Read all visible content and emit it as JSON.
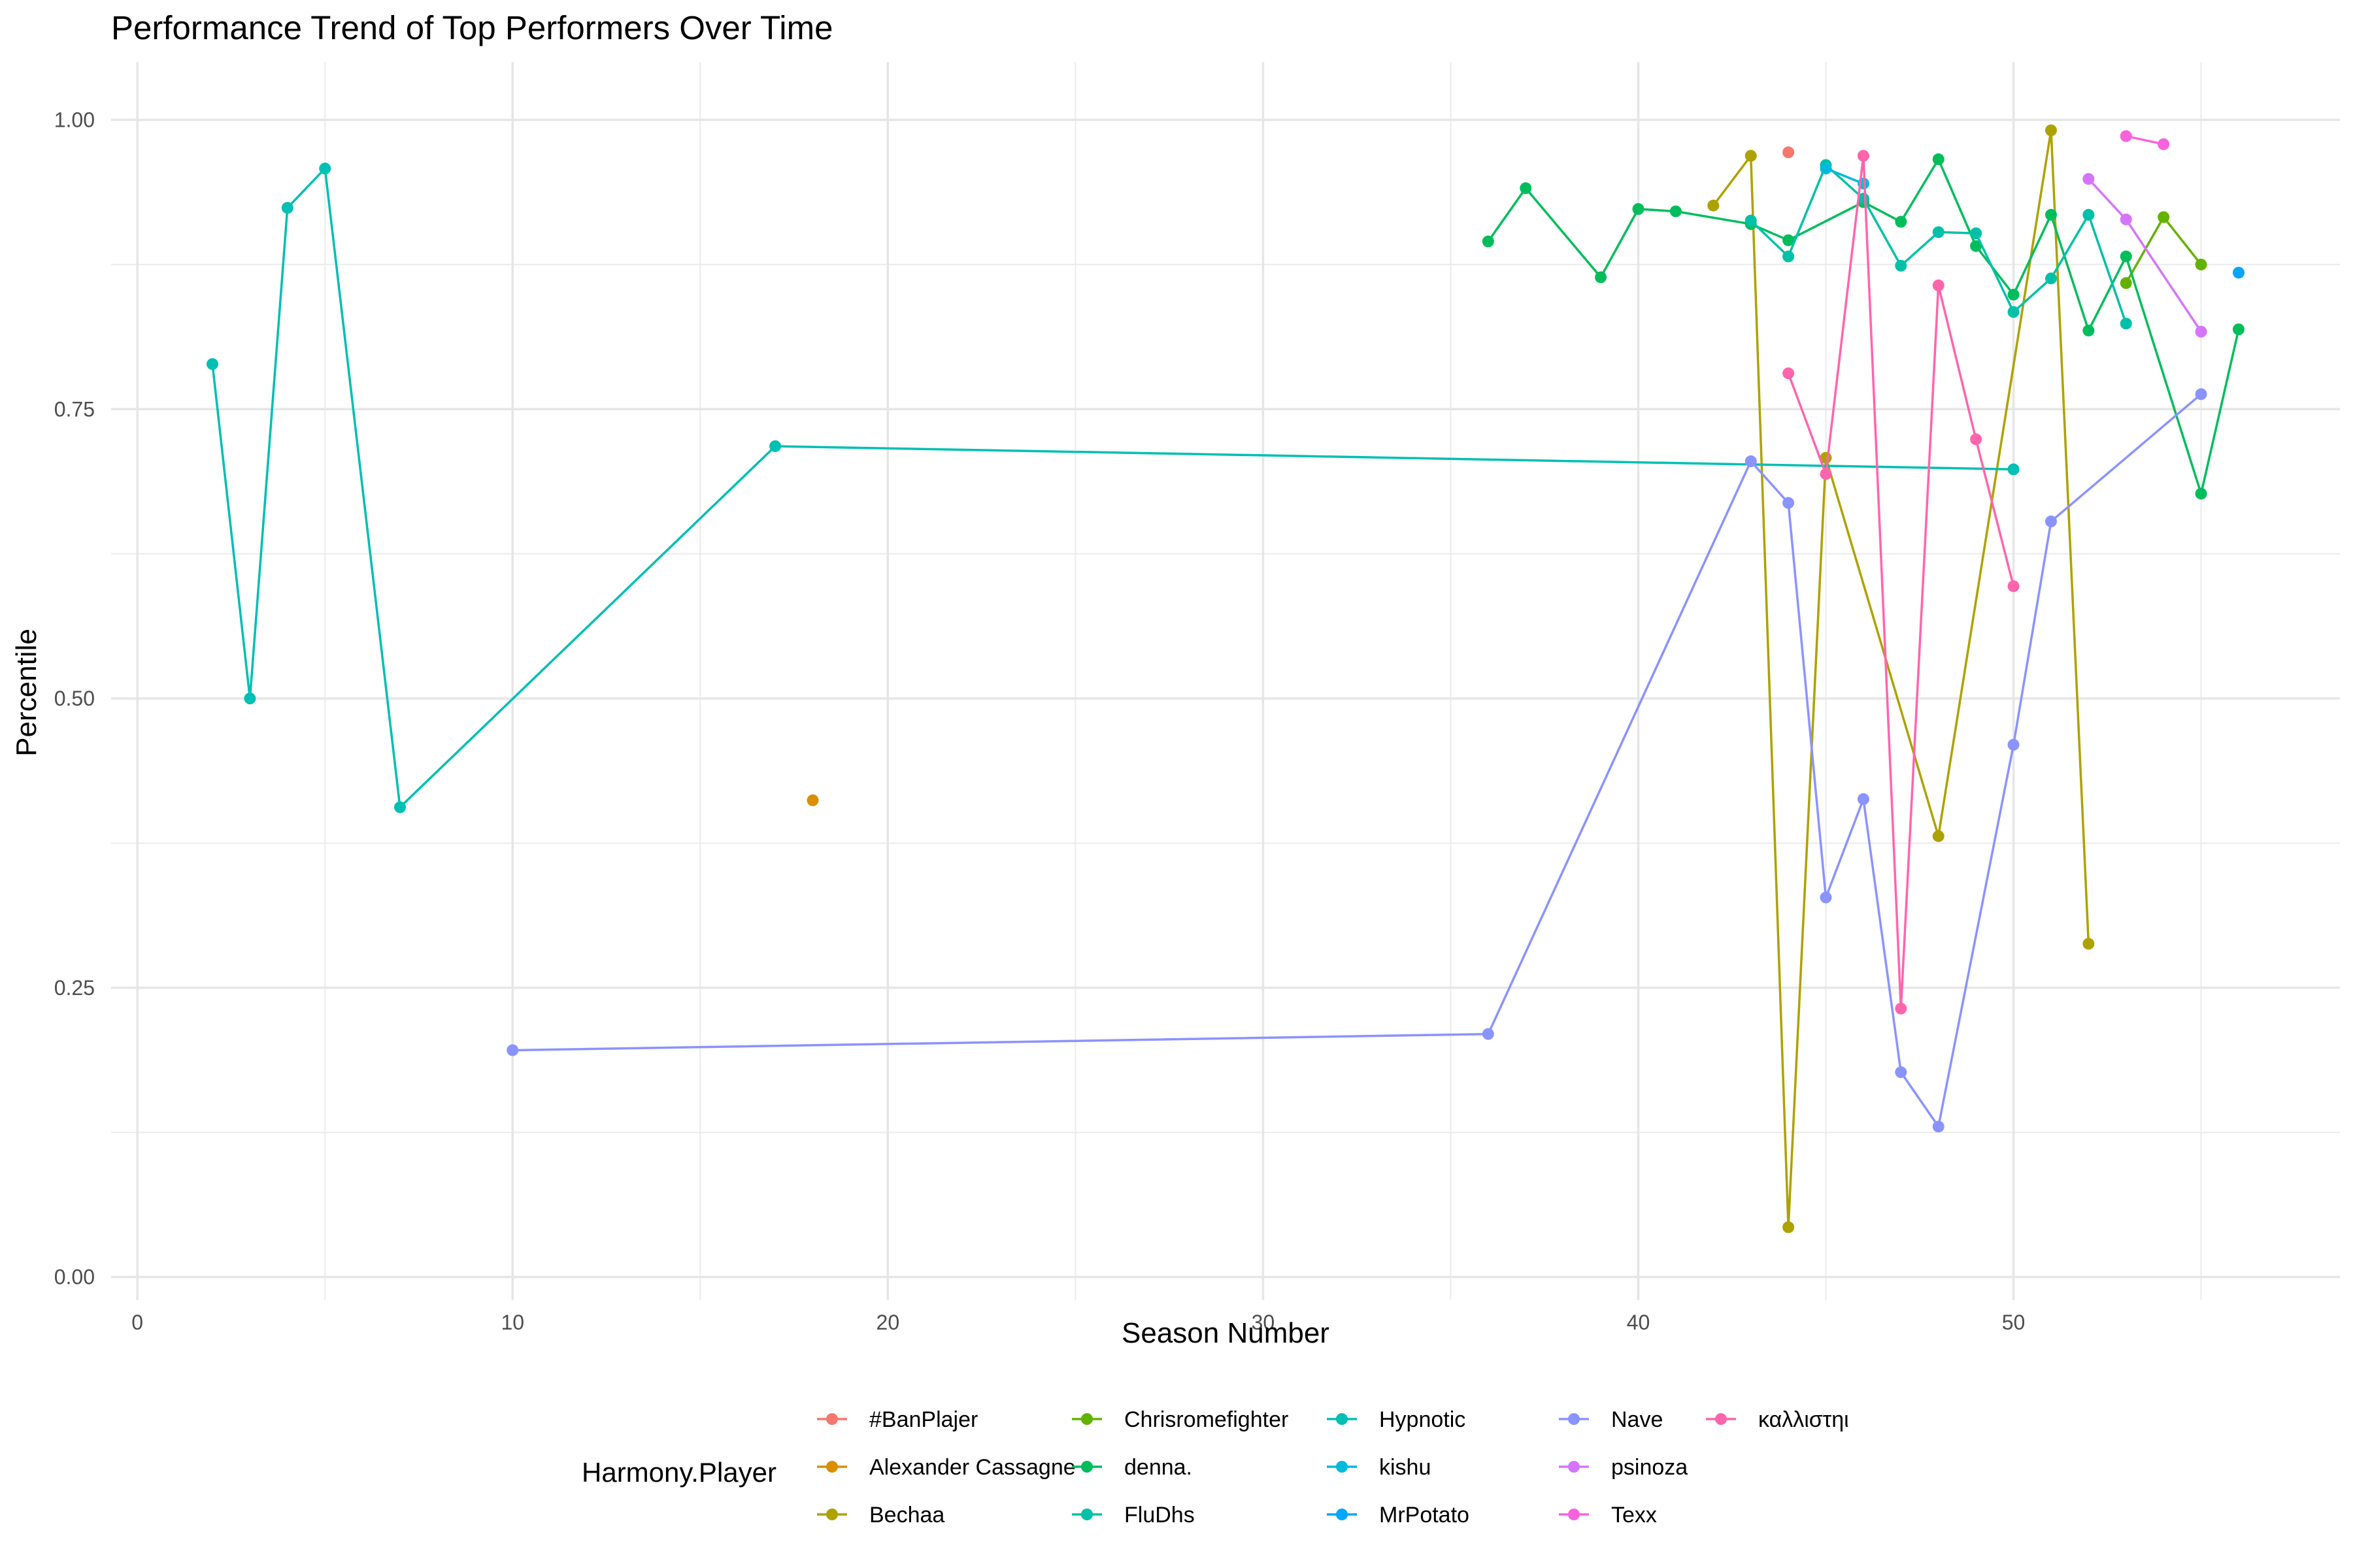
{
  "chart_data": {
    "type": "line",
    "title": "Performance Trend of Top Performers Over Time",
    "xlabel": "Season Number",
    "ylabel": "Percentile",
    "xlim": [
      -0.7,
      58.7
    ],
    "ylim": [
      0,
      1.0
    ],
    "x_ticks": [
      0,
      10,
      20,
      30,
      40,
      50
    ],
    "y_ticks": [
      0.0,
      0.25,
      0.5,
      0.75,
      1.0
    ],
    "y_tick_labels": [
      "0.00",
      "0.25",
      "0.50",
      "0.75",
      "1.00"
    ],
    "grid": true,
    "legend_title": "Harmony.Player",
    "legend_position": "bottom",
    "series": [
      {
        "name": "#BanPlajer",
        "color": "#F8766D",
        "points": [
          [
            44,
            0.972
          ]
        ]
      },
      {
        "name": "Alexander Cassagne",
        "color": "#DB8E00",
        "points": [
          [
            18,
            0.412
          ]
        ]
      },
      {
        "name": "Bechaa",
        "color": "#AEA200",
        "points": [
          [
            42,
            0.926
          ],
          [
            43,
            0.969
          ],
          [
            44,
            0.043
          ],
          [
            45,
            0.708
          ],
          [
            48,
            0.381
          ],
          [
            51,
            0.991
          ],
          [
            52,
            0.288
          ]
        ]
      },
      {
        "name": "Chrisromefighter",
        "color": "#64B200",
        "points": [
          [
            53,
            0.859
          ],
          [
            54,
            0.916
          ],
          [
            55,
            0.875
          ]
        ]
      },
      {
        "name": "denna.",
        "color": "#00BD5C",
        "points": [
          [
            36,
            0.895
          ],
          [
            37,
            0.941
          ],
          [
            39,
            0.864
          ],
          [
            40,
            0.923
          ],
          [
            41,
            0.921
          ],
          [
            43,
            0.91
          ],
          [
            44,
            0.896
          ],
          [
            46,
            0.929
          ],
          [
            47,
            0.912
          ],
          [
            48,
            0.966
          ],
          [
            49,
            0.891
          ],
          [
            50,
            0.849
          ],
          [
            51,
            0.918
          ],
          [
            52,
            0.818
          ],
          [
            53,
            0.882
          ],
          [
            55,
            0.677
          ],
          [
            56,
            0.819
          ]
        ]
      },
      {
        "name": "FluDhs",
        "color": "#00C1A7",
        "points": [
          [
            43,
            0.913
          ],
          [
            44,
            0.882
          ],
          [
            45,
            0.961
          ],
          [
            46,
            0.932
          ],
          [
            47,
            0.874
          ],
          [
            48,
            0.903
          ],
          [
            49,
            0.902
          ],
          [
            50,
            0.834
          ],
          [
            51,
            0.863
          ],
          [
            52,
            0.918
          ],
          [
            53,
            0.824
          ]
        ]
      },
      {
        "name": "Hypnotic",
        "color": "#00BFB3",
        "points": [
          [
            2,
            0.789
          ],
          [
            3,
            0.5
          ],
          [
            4,
            0.924
          ],
          [
            5,
            0.958
          ],
          [
            7,
            0.406
          ],
          [
            17,
            0.718
          ],
          [
            50,
            0.698
          ]
        ]
      },
      {
        "name": "kishu",
        "color": "#00BADE",
        "points": [
          [
            45,
            0.958
          ],
          [
            46,
            0.945
          ]
        ]
      },
      {
        "name": "MrPotato",
        "color": "#00A6FF",
        "points": [
          [
            56,
            0.868
          ]
        ]
      },
      {
        "name": "Nave",
        "color": "#8B93FF",
        "points": [
          [
            10,
            0.196
          ],
          [
            36,
            0.21
          ],
          [
            43,
            0.705
          ],
          [
            44,
            0.669
          ],
          [
            45,
            0.328
          ],
          [
            46,
            0.413
          ],
          [
            47,
            0.177
          ],
          [
            48,
            0.13
          ],
          [
            50,
            0.46
          ],
          [
            51,
            0.653
          ],
          [
            55,
            0.763
          ]
        ]
      },
      {
        "name": "psinoza",
        "color": "#D575FE",
        "points": [
          [
            52,
            0.949
          ],
          [
            53,
            0.914
          ],
          [
            55,
            0.817
          ]
        ]
      },
      {
        "name": "Texx",
        "color": "#F962DD",
        "points": [
          [
            53,
            0.986
          ],
          [
            54,
            0.979
          ]
        ]
      },
      {
        "name": "καλλιστηι",
        "color": "#FF65AC",
        "points": [
          [
            44,
            0.781
          ],
          [
            45,
            0.694
          ],
          [
            46,
            0.969
          ],
          [
            47,
            0.232
          ],
          [
            48,
            0.857
          ],
          [
            49,
            0.724
          ],
          [
            50,
            0.597
          ]
        ]
      }
    ]
  }
}
